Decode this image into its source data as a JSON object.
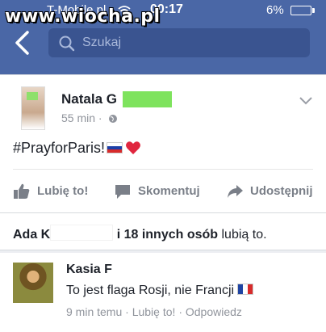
{
  "status_bar": {
    "carrier": "T-Mobile.pl",
    "time": "00:17",
    "battery": "6%"
  },
  "watermark": "www.wiocha.pl",
  "search": {
    "placeholder": "Szukaj"
  },
  "post": {
    "author": "Natala G",
    "time": "55 min",
    "text": "#PrayforParis!",
    "actions": {
      "like": "Lubię to!",
      "comment": "Skomentuj",
      "share": "Udostępnij"
    }
  },
  "likes": {
    "first_name": "Ada K",
    "others": "i 18 innych osób",
    "suffix": "lubią to."
  },
  "comment": {
    "author": "Kasia F",
    "text": "To jest flaga Rosji, nie Francji",
    "time": "9 min temu",
    "like": "Lubię to!",
    "reply": "Odpowiedz",
    "separator": "·"
  },
  "colors": {
    "header": "#4a67a6",
    "search_bg": "#3a5490",
    "meta_gray": "#90949c"
  },
  "icons": [
    "wifi-icon",
    "battery-icon",
    "back-icon",
    "search-icon",
    "globe-icon",
    "chevron-down-icon",
    "like-icon",
    "comment-icon",
    "share-icon",
    "russia-flag-icon",
    "heart-icon",
    "france-flag-icon"
  ]
}
